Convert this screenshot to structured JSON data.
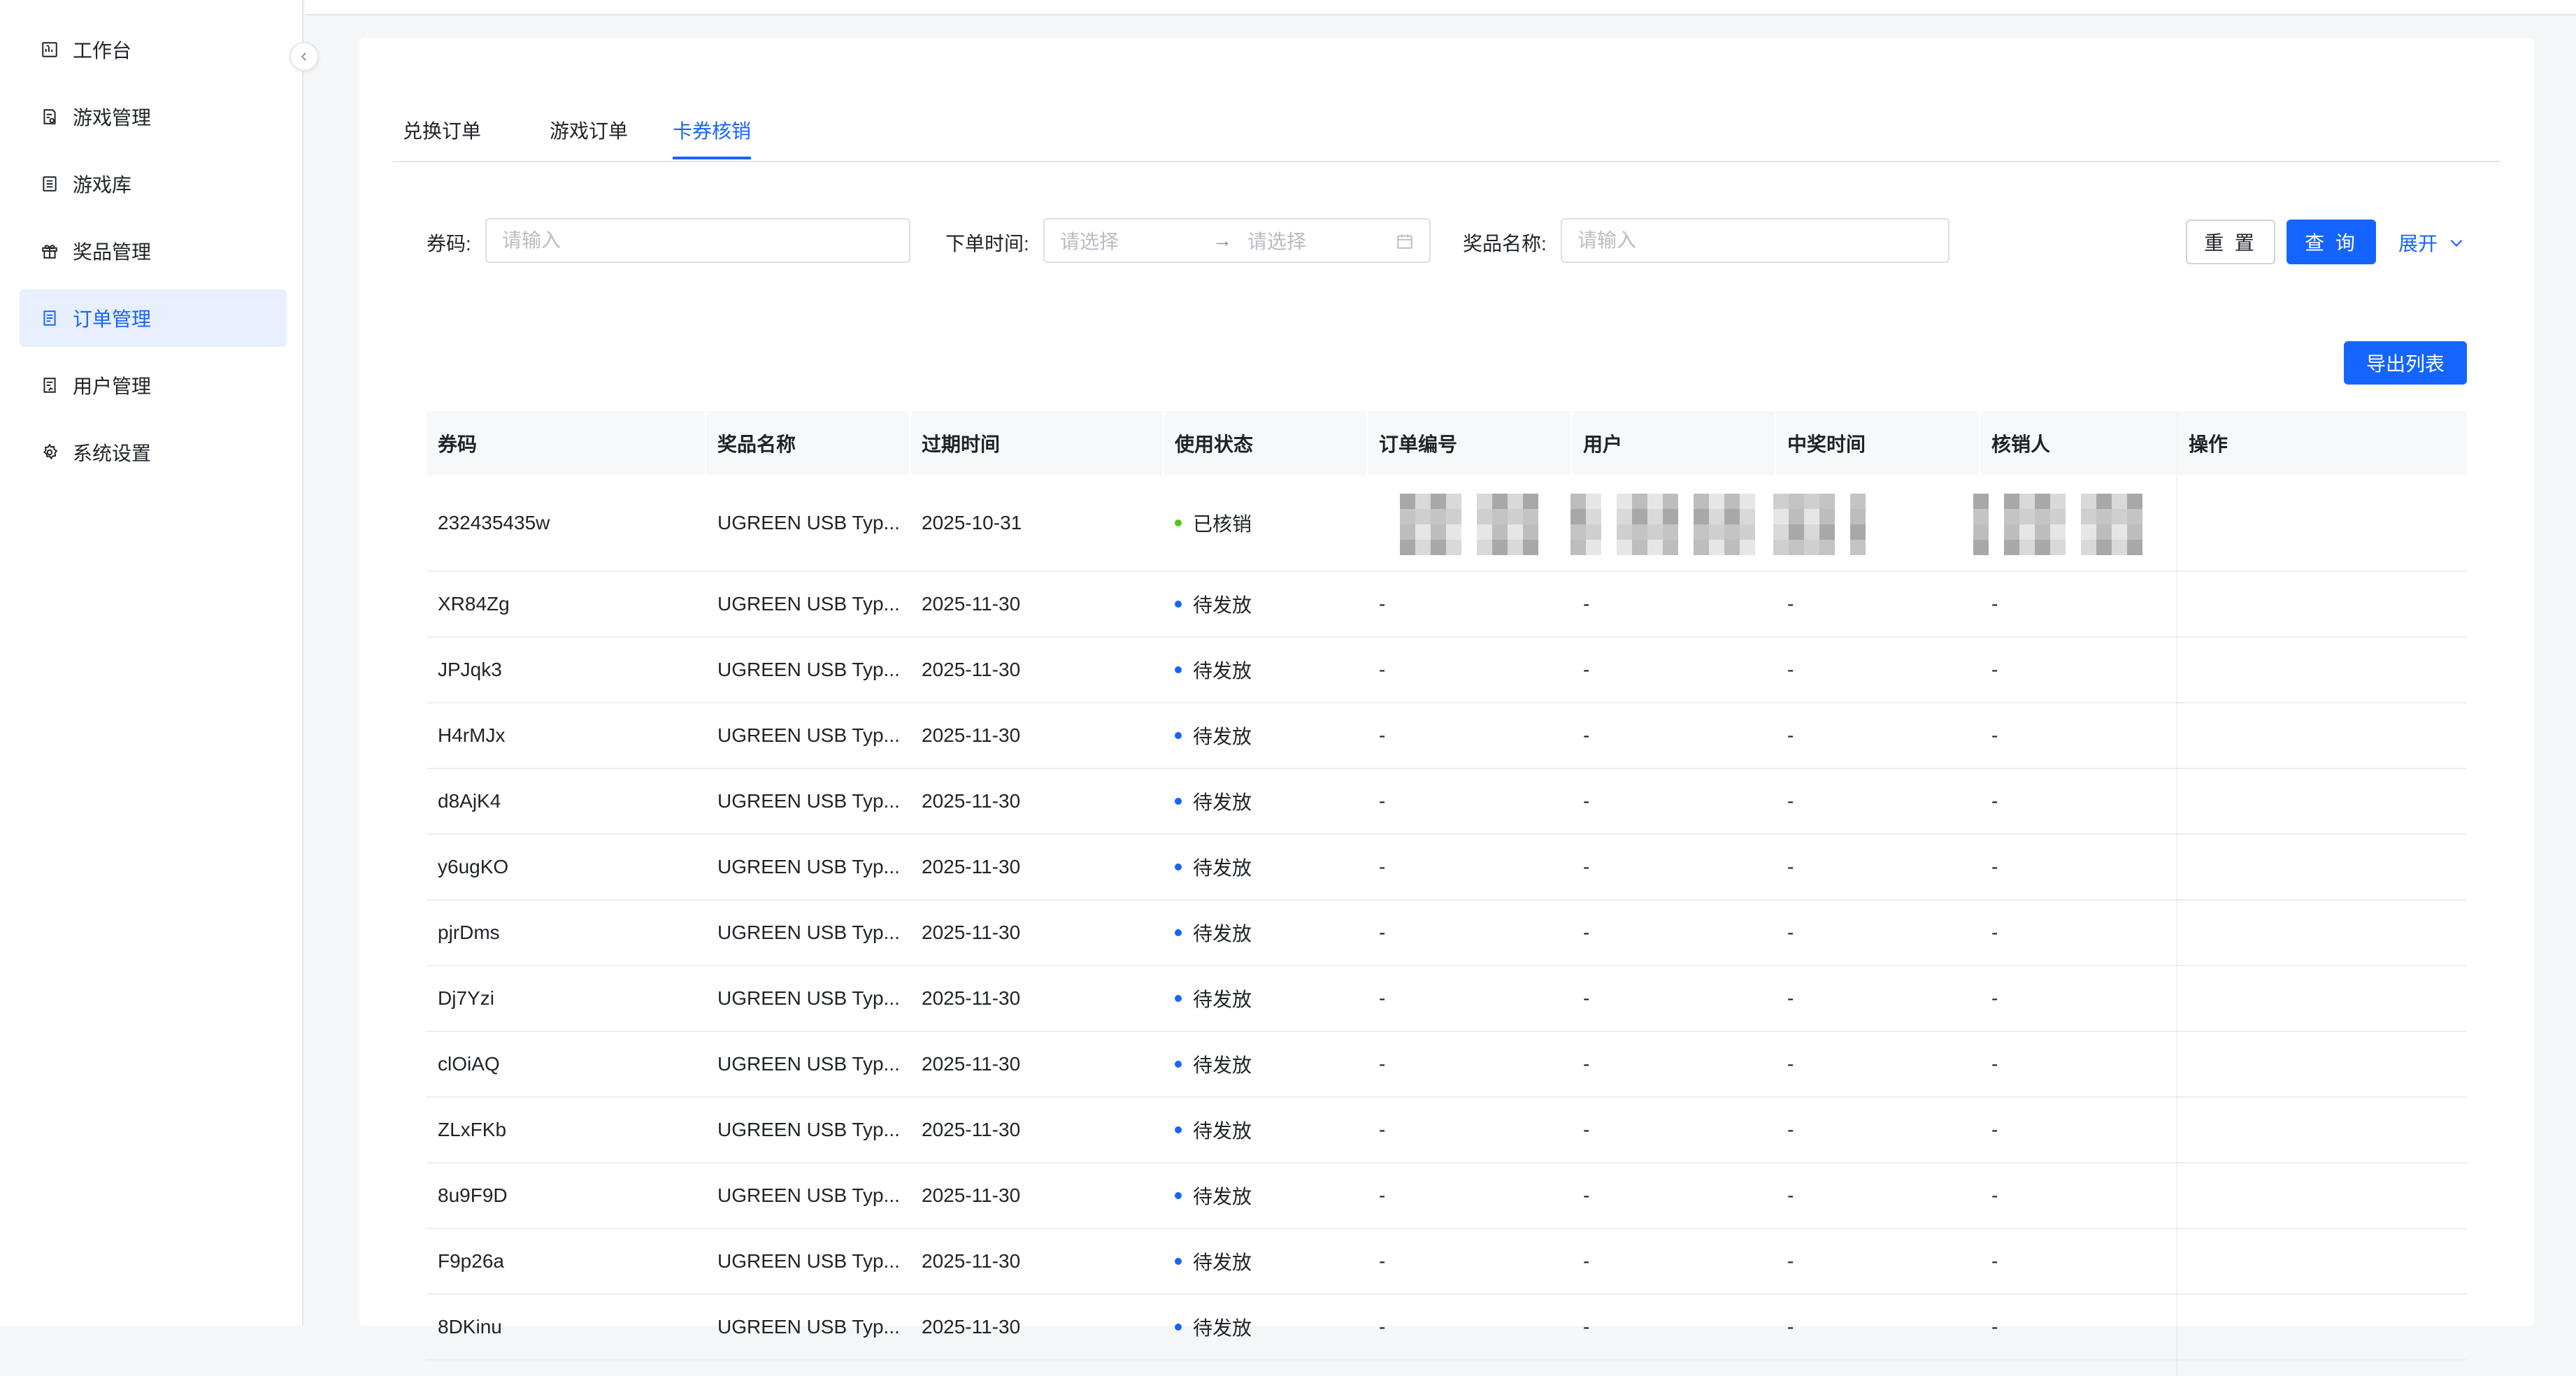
{
  "sidebar": {
    "items": [
      {
        "label": "工作台",
        "icon": "dashboard-icon",
        "active": false
      },
      {
        "label": "游戏管理",
        "icon": "game-doc-icon",
        "active": false
      },
      {
        "label": "游戏库",
        "icon": "library-icon",
        "active": false
      },
      {
        "label": "奖品管理",
        "icon": "gift-icon",
        "active": false
      },
      {
        "label": "订单管理",
        "icon": "order-icon",
        "active": true
      },
      {
        "label": "用户管理",
        "icon": "user-doc-icon",
        "active": false
      },
      {
        "label": "系统设置",
        "icon": "gear-icon",
        "active": false
      }
    ]
  },
  "tabs": [
    {
      "label": "兑换订单",
      "active": false
    },
    {
      "label": "游戏订单",
      "active": false
    },
    {
      "label": "卡券核销",
      "active": true
    }
  ],
  "filters": {
    "code_label": "券码:",
    "code_placeholder": "请输入",
    "time_label": "下单时间:",
    "time_start_placeholder": "请选择",
    "time_end_placeholder": "请选择",
    "prize_label": "奖品名称:",
    "prize_placeholder": "请输入",
    "reset_label": "重 置",
    "query_label": "查 询",
    "expand_label": "展开"
  },
  "export_label": "导出列表",
  "colors": {
    "primary": "#1664ff",
    "status_done": "#52c41a",
    "status_pending": "#1664ff"
  },
  "table": {
    "columns": [
      "券码",
      "奖品名称",
      "过期时间",
      "使用状态",
      "订单编号",
      "用户",
      "中奖时间",
      "核销人",
      "操作"
    ],
    "rows": [
      {
        "code": "232435435w",
        "prize": "UGREEN USB Typ...",
        "expire": "2025-10-31",
        "status": "已核销",
        "status_type": "done",
        "order": "",
        "user": "",
        "win_time": "",
        "verifier": ""
      },
      {
        "code": "XR84Zg",
        "prize": "UGREEN USB Typ...",
        "expire": "2025-11-30",
        "status": "待发放",
        "status_type": "pending",
        "order": "-",
        "user": "-",
        "win_time": "-",
        "verifier": "-"
      },
      {
        "code": "JPJqk3",
        "prize": "UGREEN USB Typ...",
        "expire": "2025-11-30",
        "status": "待发放",
        "status_type": "pending",
        "order": "-",
        "user": "-",
        "win_time": "-",
        "verifier": "-"
      },
      {
        "code": "H4rMJx",
        "prize": "UGREEN USB Typ...",
        "expire": "2025-11-30",
        "status": "待发放",
        "status_type": "pending",
        "order": "-",
        "user": "-",
        "win_time": "-",
        "verifier": "-"
      },
      {
        "code": "d8AjK4",
        "prize": "UGREEN USB Typ...",
        "expire": "2025-11-30",
        "status": "待发放",
        "status_type": "pending",
        "order": "-",
        "user": "-",
        "win_time": "-",
        "verifier": "-"
      },
      {
        "code": "y6ugKO",
        "prize": "UGREEN USB Typ...",
        "expire": "2025-11-30",
        "status": "待发放",
        "status_type": "pending",
        "order": "-",
        "user": "-",
        "win_time": "-",
        "verifier": "-"
      },
      {
        "code": "pjrDms",
        "prize": "UGREEN USB Typ...",
        "expire": "2025-11-30",
        "status": "待发放",
        "status_type": "pending",
        "order": "-",
        "user": "-",
        "win_time": "-",
        "verifier": "-"
      },
      {
        "code": "Dj7Yzi",
        "prize": "UGREEN USB Typ...",
        "expire": "2025-11-30",
        "status": "待发放",
        "status_type": "pending",
        "order": "-",
        "user": "-",
        "win_time": "-",
        "verifier": "-"
      },
      {
        "code": "clOiAQ",
        "prize": "UGREEN USB Typ...",
        "expire": "2025-11-30",
        "status": "待发放",
        "status_type": "pending",
        "order": "-",
        "user": "-",
        "win_time": "-",
        "verifier": "-"
      },
      {
        "code": "ZLxFKb",
        "prize": "UGREEN USB Typ...",
        "expire": "2025-11-30",
        "status": "待发放",
        "status_type": "pending",
        "order": "-",
        "user": "-",
        "win_time": "-",
        "verifier": "-"
      },
      {
        "code": "8u9F9D",
        "prize": "UGREEN USB Typ...",
        "expire": "2025-11-30",
        "status": "待发放",
        "status_type": "pending",
        "order": "-",
        "user": "-",
        "win_time": "-",
        "verifier": "-"
      },
      {
        "code": "F9p26a",
        "prize": "UGREEN USB Typ...",
        "expire": "2025-11-30",
        "status": "待发放",
        "status_type": "pending",
        "order": "-",
        "user": "-",
        "win_time": "-",
        "verifier": "-"
      },
      {
        "code": "8DKinu",
        "prize": "UGREEN USB Typ...",
        "expire": "2025-11-30",
        "status": "待发放",
        "status_type": "pending",
        "order": "-",
        "user": "-",
        "win_time": "-",
        "verifier": "-"
      }
    ]
  }
}
